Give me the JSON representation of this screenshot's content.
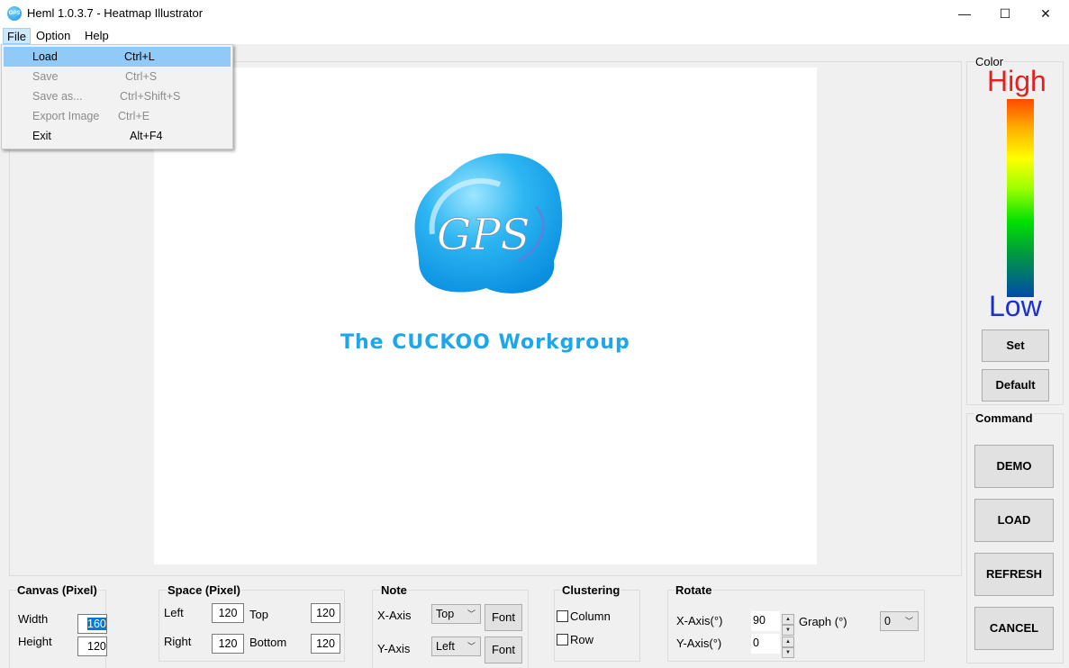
{
  "window": {
    "title": "Heml 1.0.3.7 - Heatmap Illustrator",
    "icon_text": "GPS",
    "minimize": "—",
    "maximize": "☐",
    "close": "✕"
  },
  "menubar": {
    "file": "File",
    "option": "Option",
    "help": "Help"
  },
  "file_menu": {
    "items": [
      {
        "label": "Load",
        "shortcut": "Ctrl+L",
        "enabled": true,
        "highlighted": true
      },
      {
        "label": "Save",
        "shortcut": "Ctrl+S",
        "enabled": false
      },
      {
        "label": "Save as...",
        "shortcut": "Ctrl+Shift+S",
        "enabled": false
      },
      {
        "label": "Export Image",
        "shortcut": "Ctrl+E",
        "enabled": false
      },
      {
        "label": "Exit",
        "shortcut": "Alt+F4",
        "enabled": true
      }
    ]
  },
  "canvas": {
    "logo_text": "GPS",
    "workgroup_text": "The CUCKOO Workgroup"
  },
  "color_panel": {
    "title": "Color",
    "high": "High",
    "low": "Low",
    "set": "Set",
    "default": "Default",
    "colors": {
      "high": "#e52020",
      "low": "#1a2fd8",
      "accent": "#1ea6ec"
    }
  },
  "command_panel": {
    "title": "Command",
    "demo": "DEMO",
    "load": "LOAD",
    "refresh": "REFRESH",
    "cancel": "CANCEL"
  },
  "canvas_settings": {
    "title": "Canvas (Pixel)",
    "width_label": "Width",
    "width_value": "160",
    "height_label": "Height",
    "height_value": "120"
  },
  "space_settings": {
    "title": "Space (Pixel)",
    "left_label": "Left",
    "left_value": "120",
    "top_label": "Top",
    "top_value": "120",
    "right_label": "Right",
    "right_value": "120",
    "bottom_label": "Bottom",
    "bottom_value": "120"
  },
  "note_settings": {
    "title": "Note",
    "x_label": "X-Axis",
    "x_value": "Top",
    "y_label": "Y-Axis",
    "y_value": "Left",
    "font_button": "Font"
  },
  "clustering": {
    "title": "Clustering",
    "column": "Column",
    "row": "Row"
  },
  "rotate": {
    "title": "Rotate",
    "x_label": "X-Axis(°)",
    "x_value": "90",
    "y_label": "Y-Axis(°)",
    "y_value": "0",
    "graph_label": "Graph (°)",
    "graph_value": "0"
  }
}
